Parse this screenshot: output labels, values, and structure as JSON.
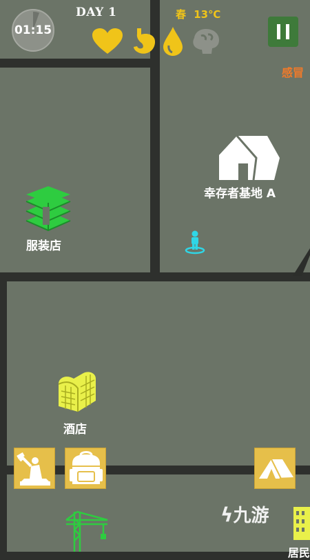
{
  "hud": {
    "timer": "01:15",
    "day": "DAY 1",
    "season": "春",
    "temperature": "13℃",
    "stats": [
      {
        "name": "health",
        "icon": "heart-icon",
        "level": 1.0
      },
      {
        "name": "hunger",
        "icon": "stomach-icon",
        "level": 1.0
      },
      {
        "name": "thirst",
        "icon": "water-drop-icon",
        "level": 1.0
      },
      {
        "name": "sanity",
        "icon": "brain-icon",
        "level": 0.4
      }
    ]
  },
  "status": {
    "effect_label": "感冒"
  },
  "map": {
    "locations": [
      {
        "name": "clothing-store",
        "label": "服装店",
        "icon": "building-stack-icon",
        "color": "#2ecc40"
      },
      {
        "name": "survivor-base",
        "label": "幸存者基地 A",
        "icon": "tent-house-icon",
        "color": "#ffffff"
      },
      {
        "name": "hotel",
        "label": "酒店",
        "icon": "hotel-building-icon",
        "color": "#e9f04a"
      },
      {
        "name": "residential",
        "label": "居民",
        "icon": "apartment-icon",
        "color": "#e9f04a"
      }
    ]
  },
  "actions": [
    {
      "name": "craft",
      "icon": "craft-figure-icon"
    },
    {
      "name": "backpack",
      "icon": "backpack-icon"
    },
    {
      "name": "camp",
      "icon": "tent-icon"
    }
  ],
  "watermark": "九游",
  "colors": {
    "accent": "#f0c419",
    "pause_bg": "#3e7a3a",
    "player": "#2fd6e6",
    "ground": "#6b7467"
  }
}
